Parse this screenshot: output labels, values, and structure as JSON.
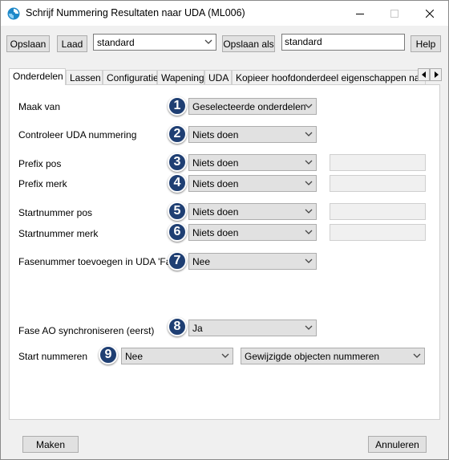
{
  "window": {
    "title": "Schrijf Nummering Resultaten naar UDA (ML006)",
    "minimize_icon": "minimize-icon",
    "maximize_icon": "maximize-icon",
    "close_icon": "close-icon"
  },
  "toolbar": {
    "save_label": "Opslaan",
    "load_label": "Laad",
    "preset_value": "standard",
    "save_as_label": "Opslaan als",
    "save_as_value": "standard",
    "help_label": "Help"
  },
  "tabs": [
    {
      "label": "Onderdelen"
    },
    {
      "label": "Lassen"
    },
    {
      "label": "Configuratie"
    },
    {
      "label": "Wapening"
    },
    {
      "label": "UDA"
    },
    {
      "label": "Kopieer hoofdonderdeel eigenschappen naar"
    }
  ],
  "form": {
    "maak_van": {
      "badge": "1",
      "label": "Maak van",
      "value": "Geselecteerde onderdelen"
    },
    "controleer": {
      "badge": "2",
      "label": "Controleer UDA nummering",
      "value": "Niets doen"
    },
    "prefix_pos": {
      "badge": "3",
      "label": "Prefix pos",
      "value": "Niets doen"
    },
    "prefix_merk": {
      "badge": "4",
      "label": "Prefix merk",
      "value": "Niets doen"
    },
    "startnummer_pos": {
      "badge": "5",
      "label": "Startnummer pos",
      "value": "Niets doen"
    },
    "startnummer_merk": {
      "badge": "6",
      "label": "Startnummer merk",
      "value": "Niets doen"
    },
    "fasenummer": {
      "badge": "7",
      "label": "Fasenummer toevoegen in UDA 'Fase'",
      "value": "Nee"
    },
    "fase_ao": {
      "badge": "8",
      "label": "Fase AO synchroniseren (eerst)",
      "value": "Ja"
    },
    "start_nummeren": {
      "badge": "9",
      "label": "Start nummeren",
      "value": "Nee",
      "value2": "Gewijzigde objecten nummeren"
    }
  },
  "footer": {
    "maken_label": "Maken",
    "annuleren_label": "Annuleren"
  },
  "colors": {
    "badge": "#1f3f73",
    "window_bg": "#f0f0f0",
    "button_bg": "#e1e1e1"
  }
}
